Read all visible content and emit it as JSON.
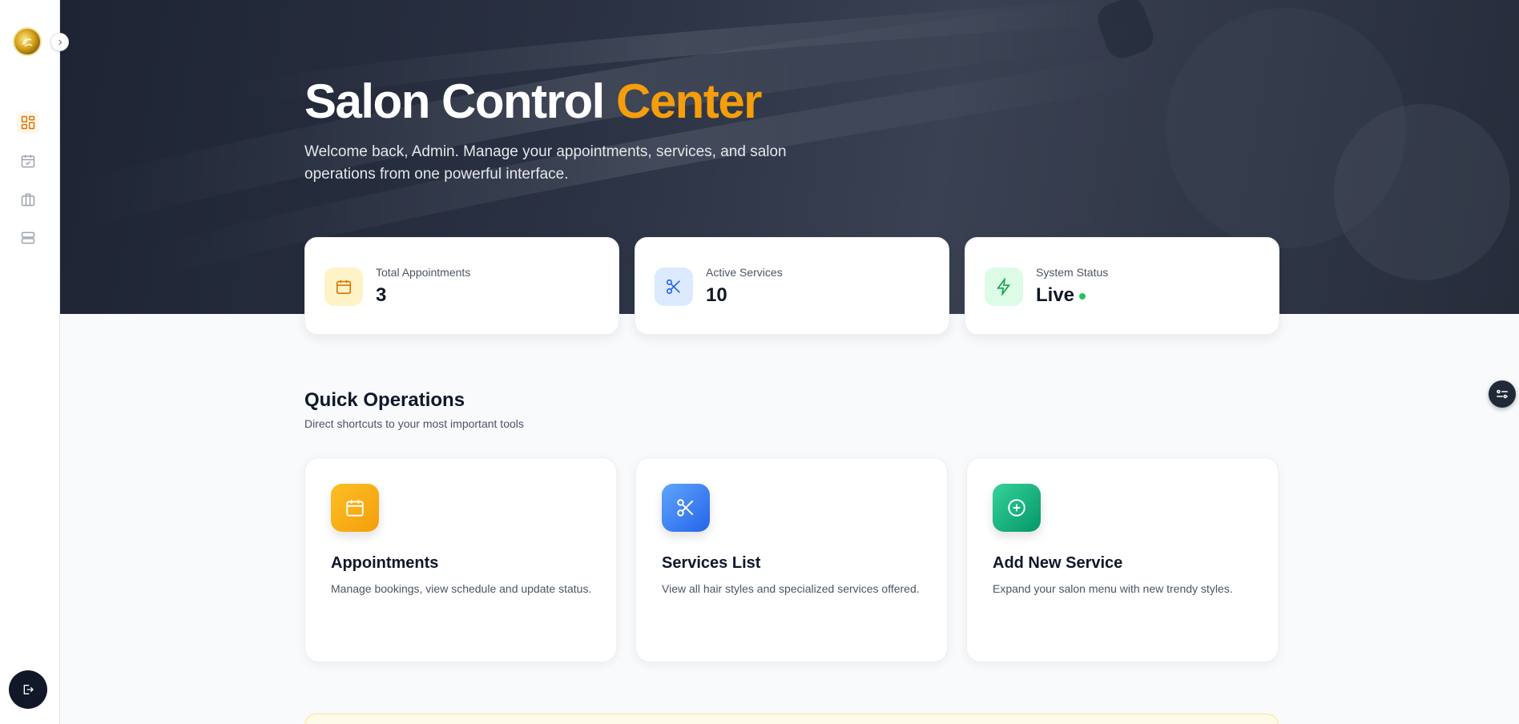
{
  "hero": {
    "title_main": "Salon Control",
    "title_accent": "Center",
    "subtitle": "Welcome back, Admin. Manage your appointments, services, and salon operations from one powerful interface."
  },
  "sidebar": {
    "items": [
      {
        "icon": "dashboard-icon",
        "active": true
      },
      {
        "icon": "calendar-check-icon",
        "active": false
      },
      {
        "icon": "briefcase-icon",
        "active": false
      },
      {
        "icon": "server-icon",
        "active": false
      }
    ],
    "logout_icon": "logout-icon"
  },
  "stats": [
    {
      "label": "Total Appointments",
      "value": "3",
      "icon": "calendar-icon",
      "color": "#d97706",
      "bg": "#fef3c7"
    },
    {
      "label": "Active Services",
      "value": "10",
      "icon": "scissors-icon",
      "color": "#2563eb",
      "bg": "#dbeafe"
    },
    {
      "label": "System Status",
      "value": "Live",
      "icon": "bolt-icon",
      "color": "#16a34a",
      "bg": "#dcfce7"
    }
  ],
  "quick_ops": {
    "title": "Quick Operations",
    "subtitle": "Direct shortcuts to your most important tools",
    "cards": [
      {
        "title": "Appointments",
        "desc": "Manage bookings, view schedule and update status.",
        "icon": "calendar-icon",
        "color": "#f59e0b"
      },
      {
        "title": "Services List",
        "desc": "View all hair styles and specialized services offered.",
        "icon": "scissors-icon",
        "color": "#3b82f6"
      },
      {
        "title": "Add New Service",
        "desc": "Expand your salon menu with new trendy styles.",
        "icon": "plus-circle-icon",
        "color": "#10b981"
      }
    ]
  },
  "colors": {
    "accent": "#f59e0b",
    "dark": "#1e2433",
    "live": "#22c55e"
  }
}
